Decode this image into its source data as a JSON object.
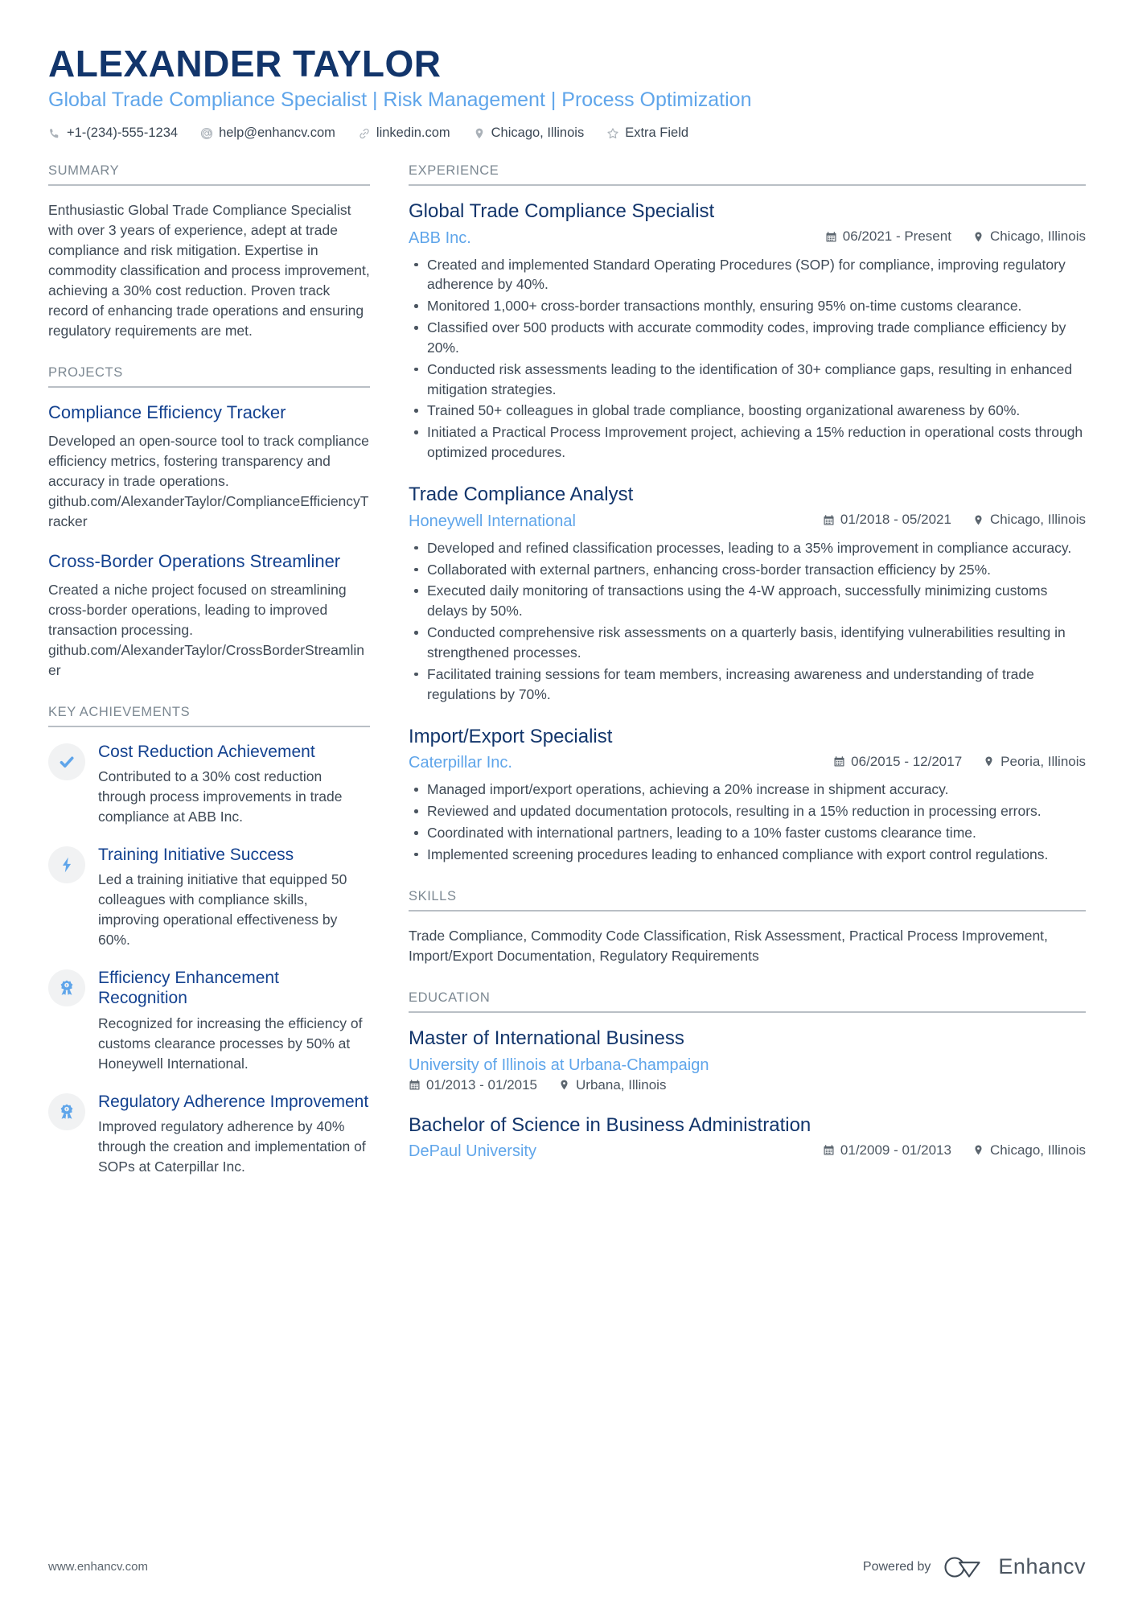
{
  "header": {
    "name": "ALEXANDER TAYLOR",
    "headline": "Global Trade Compliance Specialist | Risk Management | Process Optimization",
    "contacts": [
      {
        "icon": "phone-icon",
        "text": "+1-(234)-555-1234"
      },
      {
        "icon": "email-icon",
        "text": "help@enhancv.com"
      },
      {
        "icon": "link-icon",
        "text": "linkedin.com"
      },
      {
        "icon": "location-pin-icon",
        "text": "Chicago, Illinois"
      },
      {
        "icon": "star-icon",
        "text": "Extra Field"
      }
    ]
  },
  "summary": {
    "title": "SUMMARY",
    "text": "Enthusiastic Global Trade Compliance Specialist with over 3 years of experience, adept at trade compliance and risk mitigation. Expertise in commodity classification and process improvement, achieving a 30% cost reduction. Proven track record of enhancing trade operations and ensuring regulatory requirements are met."
  },
  "projects": {
    "title": "PROJECTS",
    "items": [
      {
        "name": "Compliance Efficiency Tracker",
        "description": "Developed an open-source tool to track compliance efficiency metrics, fostering transparency and accuracy in trade operations.",
        "link": "github.com/AlexanderTaylor/ComplianceEfficiencyTracker"
      },
      {
        "name": "Cross-Border Operations Streamliner",
        "description": "Created a niche project focused on streamlining cross-border operations, leading to improved transaction processing.",
        "link": "github.com/AlexanderTaylor/CrossBorderStreamliner"
      }
    ]
  },
  "key_achievements": {
    "title": "KEY ACHIEVEMENTS",
    "items": [
      {
        "icon": "check-icon",
        "title": "Cost Reduction Achievement",
        "description": "Contributed to a 30% cost reduction through process improvements in trade compliance at ABB Inc."
      },
      {
        "icon": "lightning-bolt-icon",
        "title": "Training Initiative Success",
        "description": "Led a training initiative that equipped 50 colleagues with compliance skills, improving operational effectiveness by 60%."
      },
      {
        "icon": "award-ribbon-icon",
        "title": "Efficiency Enhancement Recognition",
        "description": "Recognized for increasing the efficiency of customs clearance processes by 50% at Honeywell International."
      },
      {
        "icon": "award-ribbon-icon",
        "title": "Regulatory Adherence Improvement",
        "description": "Improved regulatory adherence by 40% through the creation and implementation of SOPs at Caterpillar Inc."
      }
    ]
  },
  "experience": {
    "title": "EXPERIENCE",
    "items": [
      {
        "title": "Global Trade Compliance Specialist",
        "company": "ABB Inc.",
        "dates": "06/2021 - Present",
        "location": "Chicago, Illinois",
        "bullets": [
          "Created and implemented Standard Operating Procedures (SOP) for compliance, improving regulatory adherence by 40%.",
          "Monitored 1,000+ cross-border transactions monthly, ensuring 95% on-time customs clearance.",
          "Classified over 500 products with accurate commodity codes, improving trade compliance efficiency by 20%.",
          "Conducted risk assessments leading to the identification of 30+ compliance gaps, resulting in enhanced mitigation strategies.",
          "Trained 50+ colleagues in global trade compliance, boosting organizational awareness by 60%.",
          "Initiated a Practical Process Improvement project, achieving a 15% reduction in operational costs through optimized procedures."
        ]
      },
      {
        "title": "Trade Compliance Analyst",
        "company": "Honeywell International",
        "dates": "01/2018 - 05/2021",
        "location": "Chicago, Illinois",
        "bullets": [
          "Developed and refined classification processes, leading to a 35% improvement in compliance accuracy.",
          "Collaborated with external partners, enhancing cross-border transaction efficiency by 25%.",
          "Executed daily monitoring of transactions using the 4-W approach, successfully minimizing customs delays by 50%.",
          "Conducted comprehensive risk assessments on a quarterly basis, identifying vulnerabilities resulting in strengthened processes.",
          "Facilitated training sessions for team members, increasing awareness and understanding of trade regulations by 70%."
        ]
      },
      {
        "title": "Import/Export Specialist",
        "company": "Caterpillar Inc.",
        "dates": "06/2015 - 12/2017",
        "location": "Peoria, Illinois",
        "bullets": [
          "Managed import/export operations, achieving a 20% increase in shipment accuracy.",
          "Reviewed and updated documentation protocols, resulting in a 15% reduction in processing errors.",
          "Coordinated with international partners, leading to a 10% faster customs clearance time.",
          "Implemented screening procedures leading to enhanced compliance with export control regulations."
        ]
      }
    ]
  },
  "skills": {
    "title": "SKILLS",
    "text": "Trade Compliance, Commodity Code Classification, Risk Assessment, Practical Process Improvement, Import/Export Documentation, Regulatory Requirements"
  },
  "education": {
    "title": "EDUCATION",
    "items": [
      {
        "degree": "Master of International Business",
        "school": "University of Illinois at Urbana-Champaign",
        "dates": "01/2013 - 01/2015",
        "location": "Urbana, Illinois",
        "layout": "stacked"
      },
      {
        "degree": "Bachelor of Science in Business Administration",
        "school": "DePaul University",
        "dates": "01/2009 - 01/2013",
        "location": "Chicago, Illinois",
        "layout": "inline"
      }
    ]
  },
  "footer": {
    "url": "www.enhancv.com",
    "powered_by": "Powered by",
    "brand": "Enhancv"
  },
  "colors": {
    "name_navy": "#12356b",
    "accent_blue": "#5fa5ea",
    "heading_blue": "#13418f",
    "body_gray": "#3f4a56",
    "rule_gray": "#b9bfc5"
  }
}
